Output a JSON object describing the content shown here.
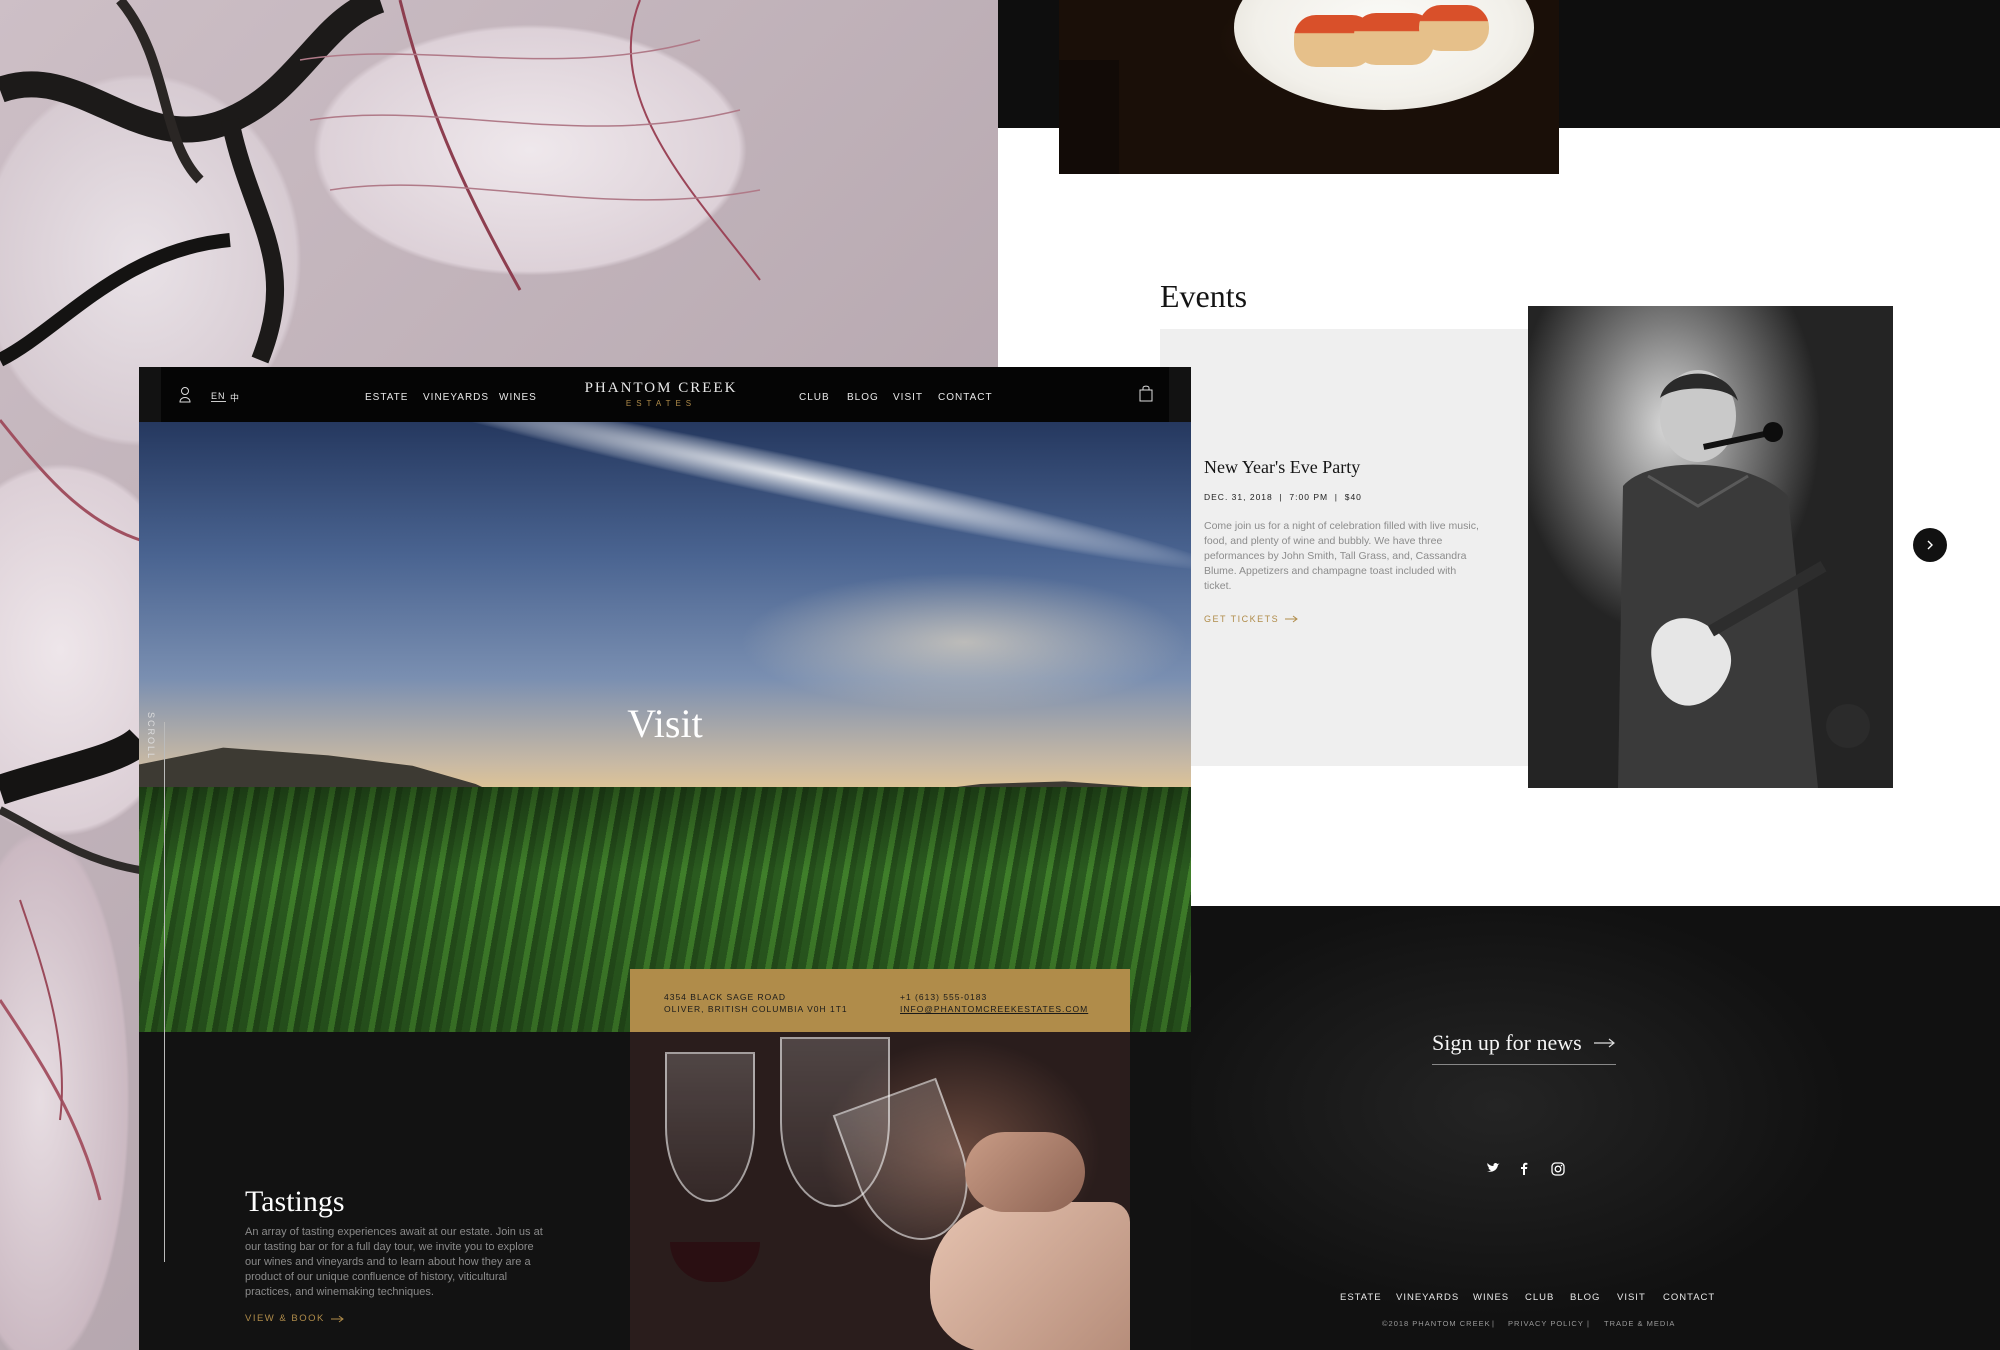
{
  "nav": {
    "lang_en": "EN",
    "lang_zh": "中",
    "left_links": [
      "ESTATE",
      "VINEYARDS",
      "WINES"
    ],
    "right_links": [
      "CLUB",
      "BLOG",
      "VISIT",
      "CONTACT"
    ],
    "brand_main": "PHANTOM CREEK",
    "brand_sub": "ESTATES"
  },
  "hero": {
    "title": "Visit",
    "scroll_label": "SCROLL"
  },
  "address": {
    "line1": "4354 BLACK SAGE ROAD",
    "line2": "OLIVER, BRITISH COLUMBIA V0H 1T1",
    "phone": "+1 (613) 555-0183",
    "email": "INFO@PHANTOMCREEKESTATES.COM"
  },
  "tastings": {
    "title": "Tastings",
    "body": "An array of tasting experiences await at our estate. Join us at our tasting bar or for a full day tour, we invite you to explore our wines and vineyards and to learn about how they are a product of our unique confluence of history, viticultural practices, and winemaking techniques.",
    "link": "VIEW & BOOK"
  },
  "events": {
    "title": "Events",
    "event_name": "New Year's Eve Party",
    "event_meta": "DEC. 31, 2018  |  7:00 PM  |  $40",
    "event_body": "Come join us for a night of celebration filled with live music, food, and plenty of wine and bubbly. We have three peformances by John Smith, Tall Grass, and, Cassandra Blume. Appetizers and champagne toast included with ticket.",
    "event_link": "GET TICKETS"
  },
  "footer": {
    "signup": "Sign up for news",
    "nav": [
      "ESTATE",
      "VINEYARDS",
      "WINES",
      "CLUB",
      "BLOG",
      "VISIT",
      "CONTACT"
    ],
    "copyright": "©2018 PHANTOM CREEK",
    "privacy": "PRIVACY POLICY",
    "trade": "TRADE & MEDIA",
    "separator": "|"
  },
  "colors": {
    "gold": "#b08c4a",
    "nav_bg": "#050505",
    "card_bg": "#efefef"
  },
  "icons": [
    "user-icon",
    "cart-icon",
    "arrow-right-icon",
    "chevron-right-icon",
    "twitter-icon",
    "facebook-icon",
    "instagram-icon"
  ]
}
